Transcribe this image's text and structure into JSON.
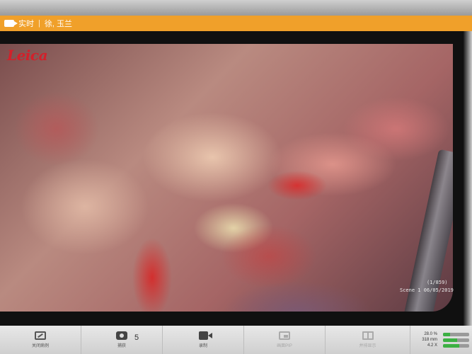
{
  "titlebar": {
    "mode": "实时",
    "patient": "徐, 玉兰"
  },
  "overlay": {
    "brand": "Leica",
    "scene_index": "(1/859)",
    "scene_label": "Scene 1",
    "scene_date": "06/05/2019"
  },
  "toolbar": {
    "close_sidebar": "关闭病例",
    "capture": "捕获",
    "capture_count": "5",
    "record": "录制",
    "pip": "画面PIP",
    "split": "并排显示"
  },
  "readouts": {
    "brightness": "28.0 %",
    "distance": "318 mm",
    "zoom": "4.2 X",
    "brightness_fill": 0.28,
    "distance_fill": 0.55,
    "zoom_fill": 0.62
  },
  "colors": {
    "titlebar": "#f0a02a",
    "brand": "#d3202a",
    "progress": "#3cb043"
  }
}
